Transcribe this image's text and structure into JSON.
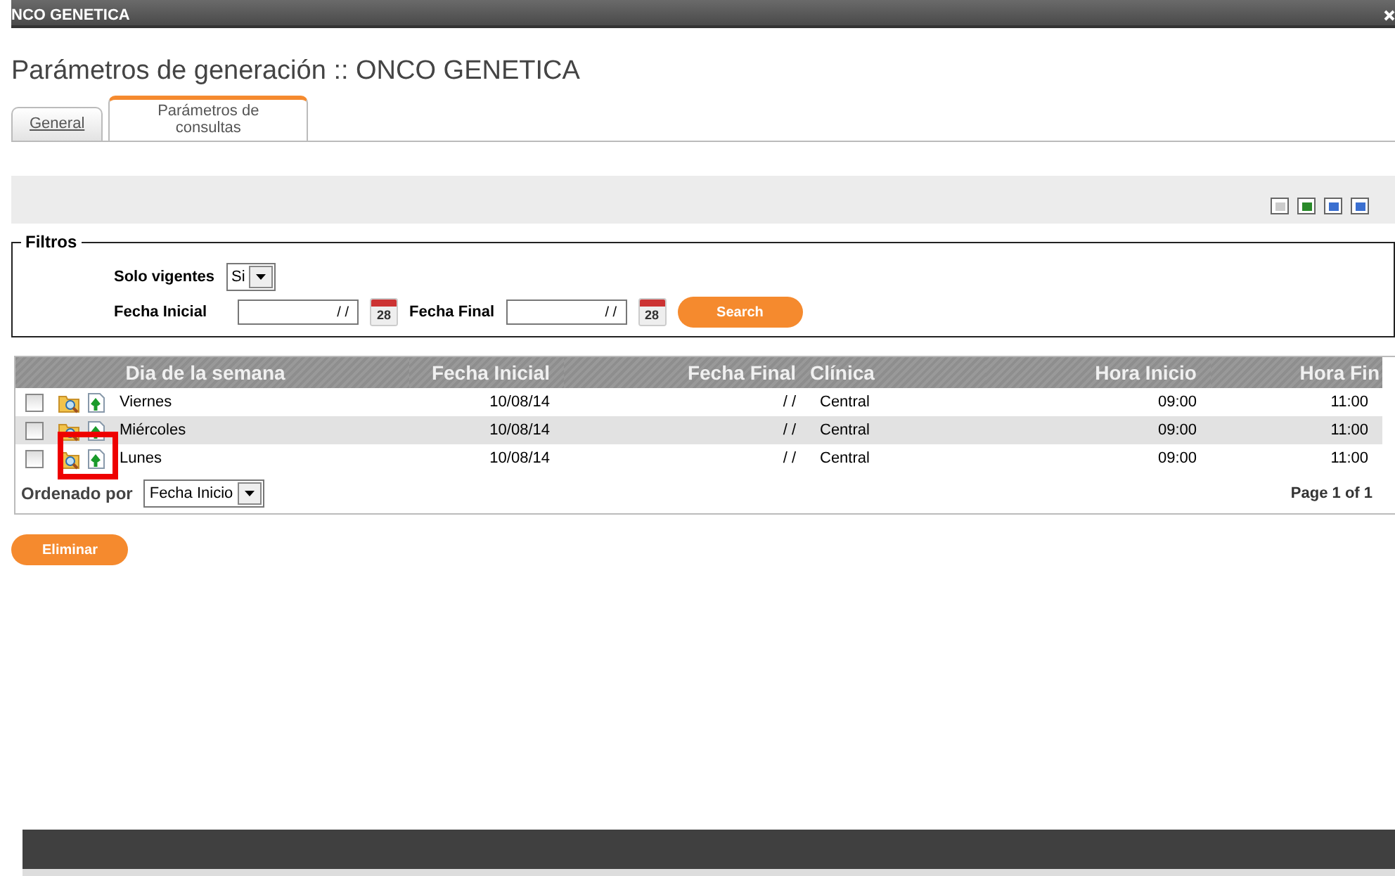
{
  "window": {
    "title": "NCO GENETICA"
  },
  "page_title": "Parámetros de generación :: ONCO GENETICA",
  "tabs": [
    {
      "label": "General",
      "selected": false
    },
    {
      "label": "Parámetros de consultas",
      "selected": true
    }
  ],
  "filters": {
    "legend": "Filtros",
    "solo_vigentes_label": "Solo vigentes",
    "solo_vigentes_value": "Si",
    "fecha_inicial_label": "Fecha Inicial",
    "fecha_inicial_value": "/ /",
    "fecha_final_label": "Fecha Final",
    "fecha_final_value": "/ /",
    "fecha_inicial_calendar": "28",
    "fecha_final_calendar": "28",
    "search_button": "Search"
  },
  "table": {
    "columns": [
      "Dia de la semana",
      "Fecha Inicial",
      "Fecha Final",
      "Clínica",
      "Hora Inicio",
      "Hora Fin"
    ],
    "rows": [
      {
        "checked": false,
        "cells": [
          "Viernes",
          "10/08/14",
          "/ /",
          "Central",
          "09:00",
          "11:00"
        ]
      },
      {
        "checked": false,
        "cells": [
          "Miércoles",
          "10/08/14",
          "/ /",
          "Central",
          "09:00",
          "11:00"
        ]
      },
      {
        "checked": false,
        "cells": [
          "Lunes",
          "10/08/14",
          "/ /",
          "Central",
          "09:00",
          "11:00"
        ]
      }
    ],
    "sort_label": "Ordenado por",
    "sort_value": "Fecha Inicio",
    "pagination": "Page 1 of 1"
  },
  "delete_button": "Eliminar"
}
